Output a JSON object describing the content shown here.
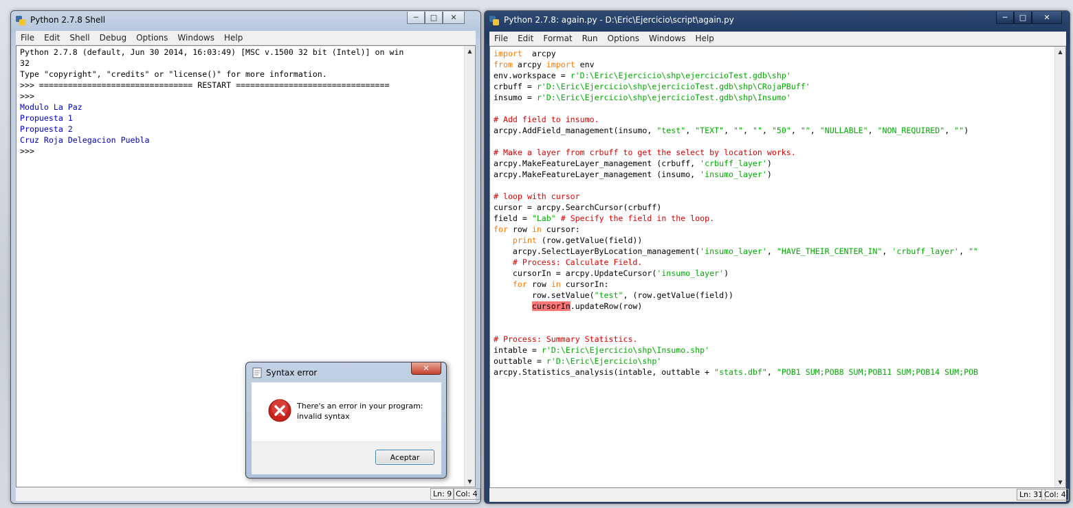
{
  "shell_window": {
    "title": "Python 2.7.8 Shell",
    "menu": [
      "File",
      "Edit",
      "Shell",
      "Debug",
      "Options",
      "Windows",
      "Help"
    ],
    "lines": [
      {
        "t": "Python 2.7.8 (default, Jun 30 2014, 16:03:49) [MSC v.1500 32 bit (Intel)] on win",
        "c": ""
      },
      {
        "t": "32",
        "c": ""
      },
      {
        "t": "Type \"copyright\", \"credits\" or \"license()\" for more information.",
        "c": ""
      },
      {
        "t": ">>> ================================ RESTART ================================",
        "c": ""
      },
      {
        "t": ">>> ",
        "c": ""
      },
      {
        "t": "Modulo La Paz",
        "c": "out"
      },
      {
        "t": "Propuesta 1",
        "c": "out"
      },
      {
        "t": "Propuesta 2",
        "c": "out"
      },
      {
        "t": "Cruz Roja Delegacion Puebla",
        "c": "out"
      },
      {
        "t": ">>> ",
        "c": ""
      }
    ],
    "status_ln": "Ln: 9",
    "status_col": "Col: 4"
  },
  "editor_window": {
    "title": "Python 2.7.8: again.py - D:\\Eric\\Ejercicio\\script\\again.py",
    "menu": [
      "File",
      "Edit",
      "Format",
      "Run",
      "Options",
      "Windows",
      "Help"
    ],
    "lines": [
      [
        [
          "kw",
          "import"
        ],
        [
          "",
          "  arcpy"
        ]
      ],
      [
        [
          "kw",
          "from"
        ],
        [
          "",
          " arcpy "
        ],
        [
          "kw",
          "import"
        ],
        [
          "",
          " env"
        ]
      ],
      [
        [
          "",
          "env.workspace = "
        ],
        [
          "str",
          "r'D:\\Eric\\Ejercicio\\shp\\ejercicioTest.gdb\\shp'"
        ]
      ],
      [
        [
          "",
          "crbuff = "
        ],
        [
          "str",
          "r'D:\\Eric\\Ejercicio\\shp\\ejercicioTest.gdb\\shp\\CRojaPBuff'"
        ]
      ],
      [
        [
          "",
          "insumo = "
        ],
        [
          "str",
          "r'D:\\Eric\\Ejercicio\\shp\\ejercicioTest.gdb\\shp\\Insumo'"
        ]
      ],
      [],
      [
        [
          "cmt",
          "# Add field to insumo."
        ]
      ],
      [
        [
          "",
          "arcpy.AddField_management(insumo, "
        ],
        [
          "str",
          "\"test\""
        ],
        [
          "",
          ", "
        ],
        [
          "str",
          "\"TEXT\""
        ],
        [
          "",
          ", "
        ],
        [
          "str",
          "\"\""
        ],
        [
          "",
          ", "
        ],
        [
          "str",
          "\"\""
        ],
        [
          "",
          ", "
        ],
        [
          "str",
          "\"50\""
        ],
        [
          "",
          ", "
        ],
        [
          "str",
          "\"\""
        ],
        [
          "",
          ", "
        ],
        [
          "str",
          "\"NULLABLE\""
        ],
        [
          "",
          ", "
        ],
        [
          "str",
          "\"NON_REQUIRED\""
        ],
        [
          "",
          ", "
        ],
        [
          "str",
          "\"\""
        ],
        [
          "",
          ")"
        ]
      ],
      [],
      [
        [
          "cmt",
          "# Make a layer from crbuff to get the select by location works."
        ]
      ],
      [
        [
          "",
          "arcpy.MakeFeatureLayer_management (crbuff, "
        ],
        [
          "str",
          "'crbuff_layer'"
        ],
        [
          "",
          ")"
        ]
      ],
      [
        [
          "",
          "arcpy.MakeFeatureLayer_management (insumo, "
        ],
        [
          "str",
          "'insumo_layer'"
        ],
        [
          "",
          ")"
        ]
      ],
      [],
      [
        [
          "cmt",
          "# loop with cursor"
        ]
      ],
      [
        [
          "",
          "cursor = arcpy.SearchCursor(crbuff)"
        ]
      ],
      [
        [
          "",
          "field = "
        ],
        [
          "str",
          "\"Lab\""
        ],
        [
          "",
          " "
        ],
        [
          "cmt",
          "# Specify the field in the loop."
        ]
      ],
      [
        [
          "kw",
          "for"
        ],
        [
          "",
          " row "
        ],
        [
          "kw",
          "in"
        ],
        [
          "",
          " cursor:"
        ]
      ],
      [
        [
          "",
          "    "
        ],
        [
          "kw",
          "print"
        ],
        [
          "",
          " (row.getValue(field))"
        ]
      ],
      [
        [
          "",
          "    arcpy.SelectLayerByLocation_management("
        ],
        [
          "str",
          "'insumo_layer'"
        ],
        [
          "",
          ", "
        ],
        [
          "str",
          "\"HAVE_THEIR_CENTER_IN\""
        ],
        [
          "",
          ", "
        ],
        [
          "str",
          "'crbuff_layer'"
        ],
        [
          "",
          ", "
        ],
        [
          "str",
          "\"\""
        ]
      ],
      [
        [
          "",
          "    "
        ],
        [
          "cmt",
          "# Process: Calculate Field."
        ]
      ],
      [
        [
          "",
          "    cursorIn = arcpy.UpdateCursor("
        ],
        [
          "str",
          "'insumo_layer'"
        ],
        [
          "",
          ")"
        ]
      ],
      [
        [
          "",
          "    "
        ],
        [
          "kw",
          "for"
        ],
        [
          "",
          " row "
        ],
        [
          "kw",
          "in"
        ],
        [
          "",
          " cursorIn:"
        ]
      ],
      [
        [
          "",
          "        row.setValue("
        ],
        [
          "str",
          "\"test\""
        ],
        [
          "",
          ", (row.getValue(field))"
        ]
      ],
      [
        [
          "",
          "        "
        ],
        [
          "err",
          "cursorIn"
        ],
        [
          "",
          ".updateRow(row)"
        ]
      ],
      [],
      [],
      [
        [
          "cmt",
          "# Process: Summary Statistics."
        ]
      ],
      [
        [
          "",
          "intable = "
        ],
        [
          "str",
          "r'D:\\Eric\\Ejercicio\\shp\\Insumo.shp'"
        ]
      ],
      [
        [
          "",
          "outtable = "
        ],
        [
          "str",
          "r'D:\\Eric\\Ejercicio\\shp'"
        ]
      ],
      [
        [
          "",
          "arcpy.Statistics_analysis(intable, outtable + "
        ],
        [
          "str",
          "\"stats.dbf\""
        ],
        [
          "",
          ", "
        ],
        [
          "str",
          "\"POB1 SUM;POB8 SUM;POB11 SUM;POB14 SUM;POB"
        ]
      ]
    ],
    "status_ln": "Ln: 31",
    "status_col": "Col: 4"
  },
  "dialog": {
    "title": "Syntax error",
    "message_line1": "There's an error in your program:",
    "message_line2": "invalid syntax",
    "button": "Aceptar"
  },
  "colors": {
    "keyword": "#ff7700",
    "string": "#00aa00",
    "comment": "#dd0000",
    "output": "#0000c0",
    "error_highlight": "#ff7777"
  }
}
